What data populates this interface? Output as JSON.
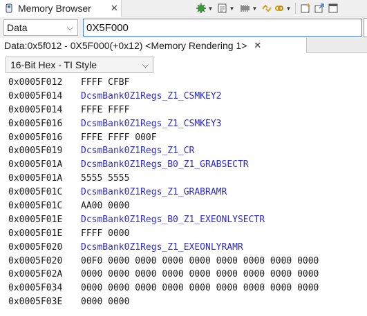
{
  "view": {
    "title": "Memory Browser",
    "close_glyph": "✕",
    "icon": "memory-chip-icon"
  },
  "toolbar": {
    "icons": [
      "continuous-refresh-icon",
      "refresh-icon",
      "pin-icon",
      "sync-icon",
      "new-view-icon",
      "export-icon",
      "maximize-icon"
    ],
    "caret": "▼"
  },
  "address_bar": {
    "space_select": "Data",
    "address_value": "0X5F000",
    "chevron": "⌵"
  },
  "rendering_tab": {
    "label": "Data:0x5f012 - 0X5F000(+0x12) <Memory Rendering 1>",
    "close_glyph": "✕"
  },
  "format_select": {
    "value": "16-Bit Hex - TI Style",
    "chevron": "⌵"
  },
  "memory_rows": [
    {
      "address": "0x0005F012",
      "content": "FFFF CFBF",
      "kind": "value"
    },
    {
      "address": "0x0005F014",
      "content": "DcsmBank0Z1Regs_Z1_CSMKEY2",
      "kind": "symbol"
    },
    {
      "address": "0x0005F014",
      "content": "FFFE FFFF",
      "kind": "value"
    },
    {
      "address": "0x0005F016",
      "content": "DcsmBank0Z1Regs_Z1_CSMKEY3",
      "kind": "symbol"
    },
    {
      "address": "0x0005F016",
      "content": "FFFE FFFF 000F",
      "kind": "value"
    },
    {
      "address": "0x0005F019",
      "content": "DcsmBank0Z1Regs_Z1_CR",
      "kind": "symbol"
    },
    {
      "address": "0x0005F01A",
      "content": "DcsmBank0Z1Regs_B0_Z1_GRABSECTR",
      "kind": "symbol"
    },
    {
      "address": "0x0005F01A",
      "content": "5555 5555",
      "kind": "value"
    },
    {
      "address": "0x0005F01C",
      "content": "DcsmBank0Z1Regs_Z1_GRABRAMR",
      "kind": "symbol"
    },
    {
      "address": "0x0005F01C",
      "content": "AA00 0000",
      "kind": "value"
    },
    {
      "address": "0x0005F01E",
      "content": "DcsmBank0Z1Regs_B0_Z1_EXEONLYSECTR",
      "kind": "symbol"
    },
    {
      "address": "0x0005F01E",
      "content": "FFFF 0000",
      "kind": "value"
    },
    {
      "address": "0x0005F020",
      "content": "DcsmBank0Z1Regs_Z1_EXEONLYRAMR",
      "kind": "symbol"
    },
    {
      "address": "0x0005F020",
      "content": "00F0 0000 0000 0000 0000 0000 0000 0000 0000",
      "kind": "value"
    },
    {
      "address": "0x0005F02A",
      "content": "0000 0000 0000 0000 0000 0000 0000 0000 0000",
      "kind": "value"
    },
    {
      "address": "0x0005F034",
      "content": "0000 0000 0000 0000 0000 0000 0000 0000 0000",
      "kind": "value"
    },
    {
      "address": "0x0005F03E",
      "content": "0000 0000",
      "kind": "value"
    }
  ],
  "colors": {
    "symbol": "#2b2bc8",
    "value": "#1a1a1a",
    "focus_border": "#4a8ad6"
  }
}
